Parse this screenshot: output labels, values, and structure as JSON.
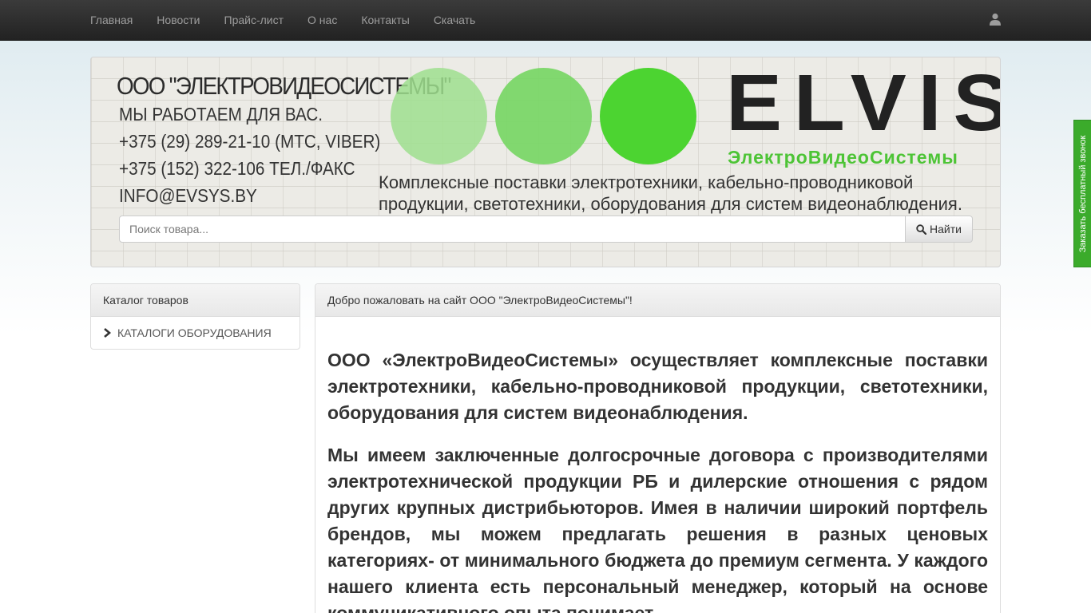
{
  "nav": {
    "items": [
      "Главная",
      "Новости",
      "Прайс-лист",
      "О нас",
      "Контакты",
      "Скачать"
    ],
    "user_icon": "user-icon"
  },
  "banner": {
    "company": "ООО \"ЭЛЕКТРОВИДЕОСИСТЕМЫ\"",
    "lines": [
      "МЫ РАБОТАЕМ ДЛЯ ВАС.",
      "+375 (29) 289-21-10 (МТС, VIBER)",
      "+375 (152) 322-106 ТЕЛ./ФАКС",
      "INFO@EVSYS.BY"
    ],
    "logo": "ELVIS",
    "logo_sub": "ЭлектроВидеоСистемы",
    "desc_line1": "Комплексные поставки электротехники, кабельно-проводниковой",
    "desc_line2": "продукции, светотехники, оборудования для систем видеонаблюдения.",
    "colors": {
      "circle_light": "#9fdf8e",
      "circle_mid": "#75d662",
      "circle_strong": "#4cd431",
      "logo_green": "#4dc436"
    }
  },
  "search": {
    "placeholder": "Поиск товара...",
    "button": "Найти"
  },
  "callback_tab": "Заказать бесплатный звонок",
  "catalog": {
    "heading": "Каталог товаров",
    "item": "КАТАЛОГИ ОБОРУДОВАНИЯ"
  },
  "main": {
    "heading": "Добро пожаловать на сайт ООО \"ЭлектроВидеоСистемы\"!",
    "p1": "ООО «ЭлектроВидеоСистемы»  осуществляет комплексные поставки электротехники, кабельно-проводниковой продукции, светотехники, оборудования для систем видеонаблюдения.",
    "p2": "Мы имеем заключенные долгосрочные договора с производителями электротехнической продукции РБ и дилерские отношения с рядом других крупных дистрибьюторов. Имея в наличии широкий портфель брендов, мы можем предлагать решения в разных ценовых категориях- от минимального бюджета до премиум сегмента. У каждого нашего клиента есть персональный менеджер, который на основе коммуникативного опыта понимает"
  }
}
